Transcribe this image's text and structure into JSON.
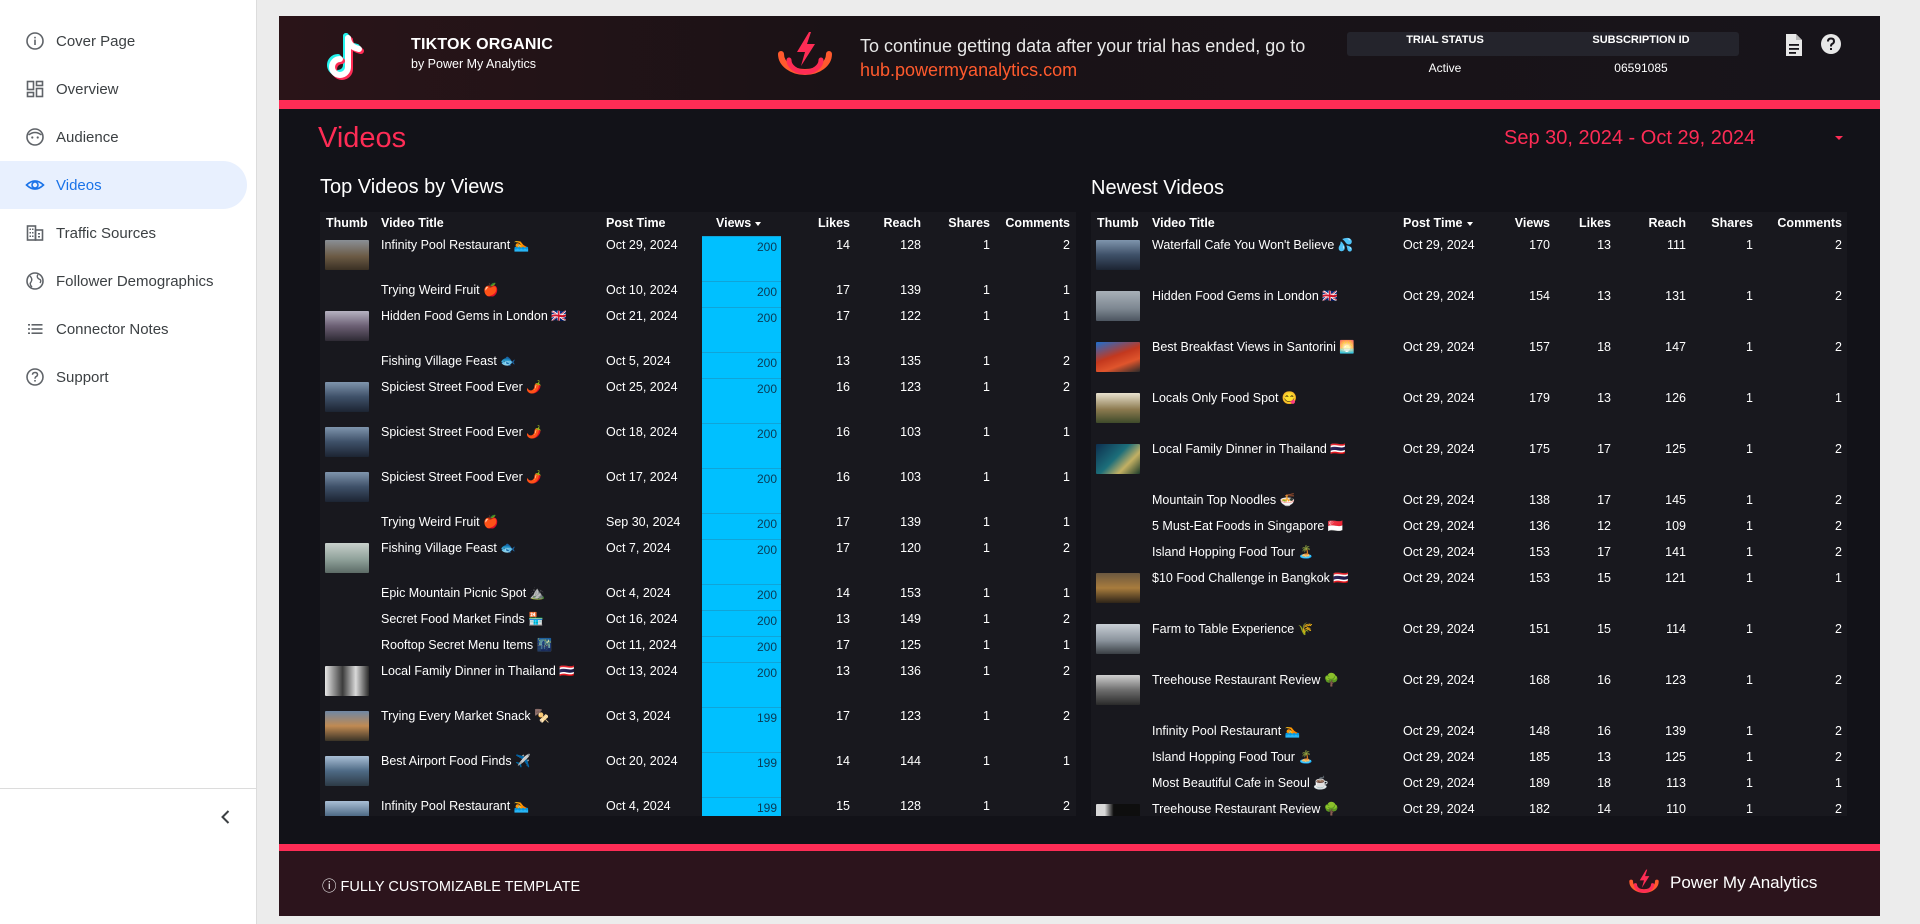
{
  "sidebar": {
    "items": [
      {
        "label": "Cover Page",
        "icon": "info-icon"
      },
      {
        "label": "Overview",
        "icon": "dashboard-icon"
      },
      {
        "label": "Audience",
        "icon": "face-icon"
      },
      {
        "label": "Videos",
        "icon": "eye-icon",
        "active": true
      },
      {
        "label": "Traffic Sources",
        "icon": "building-icon"
      },
      {
        "label": "Follower Demographics",
        "icon": "globe-icon"
      },
      {
        "label": "Connector Notes",
        "icon": "list-icon"
      },
      {
        "label": "Support",
        "icon": "help-circle-icon"
      }
    ]
  },
  "header": {
    "brand_title": "TIKTOK ORGANIC",
    "brand_sub": "by Power My Analytics",
    "trial_message": "To continue getting data after your trial has ended, go to",
    "trial_link": "hub.powermyanalytics.com",
    "trial_status_label": "TRIAL STATUS",
    "trial_status_value": "Active",
    "subscription_label": "SUBSCRIPTION ID",
    "subscription_value": "06591085"
  },
  "page": {
    "title": "Videos",
    "date_range": "Sep 30, 2024 - Oct 29, 2024"
  },
  "colors": {
    "accent": "#fe2c55",
    "views_fill": "#00c0ff",
    "link": "#ff5a2d"
  },
  "top_videos": {
    "title": "Top Videos by Views",
    "columns": [
      "Thumb",
      "Video Title",
      "Post Time",
      "Views",
      "Likes",
      "Reach",
      "Shares",
      "Comments"
    ],
    "rows": [
      {
        "thumb": "landscape",
        "title": "Infinity Pool Restaurant 🏊",
        "post_time": "Oct 29, 2024",
        "views": "200",
        "likes": "14",
        "reach": "128",
        "shares": "1",
        "comments": "2",
        "tall": true
      },
      {
        "thumb": "",
        "title": "Trying Weird Fruit 🍎",
        "post_time": "Oct 10, 2024",
        "views": "200",
        "likes": "17",
        "reach": "139",
        "shares": "1",
        "comments": "1",
        "tall": false
      },
      {
        "thumb": "forest",
        "title": "Hidden Food Gems in London 🇬🇧",
        "post_time": "Oct 21, 2024",
        "views": "200",
        "likes": "17",
        "reach": "122",
        "shares": "1",
        "comments": "1",
        "tall": true
      },
      {
        "thumb": "",
        "title": "Fishing Village Feast 🐟",
        "post_time": "Oct 5, 2024",
        "views": "200",
        "likes": "13",
        "reach": "135",
        "shares": "1",
        "comments": "2",
        "tall": false
      },
      {
        "thumb": "sky",
        "title": "Spiciest Street Food Ever 🌶️",
        "post_time": "Oct 25, 2024",
        "views": "200",
        "likes": "16",
        "reach": "123",
        "shares": "1",
        "comments": "2",
        "tall": true
      },
      {
        "thumb": "sky",
        "title": "Spiciest Street Food Ever 🌶️",
        "post_time": "Oct 18, 2024",
        "views": "200",
        "likes": "16",
        "reach": "103",
        "shares": "1",
        "comments": "1",
        "tall": true
      },
      {
        "thumb": "sky",
        "title": "Spiciest Street Food Ever 🌶️",
        "post_time": "Oct 17, 2024",
        "views": "200",
        "likes": "16",
        "reach": "103",
        "shares": "1",
        "comments": "1",
        "tall": true
      },
      {
        "thumb": "",
        "title": "Trying Weird Fruit 🍎",
        "post_time": "Sep 30, 2024",
        "views": "200",
        "likes": "17",
        "reach": "139",
        "shares": "1",
        "comments": "1",
        "tall": false
      },
      {
        "thumb": "mist",
        "title": "Fishing Village Feast 🐟",
        "post_time": "Oct 7, 2024",
        "views": "200",
        "likes": "17",
        "reach": "120",
        "shares": "1",
        "comments": "2",
        "tall": true
      },
      {
        "thumb": "",
        "title": "Epic Mountain Picnic Spot ⛰️",
        "post_time": "Oct 4, 2024",
        "views": "200",
        "likes": "14",
        "reach": "153",
        "shares": "1",
        "comments": "1",
        "tall": false
      },
      {
        "thumb": "",
        "title": "Secret Food Market Finds 🏪",
        "post_time": "Oct 16, 2024",
        "views": "200",
        "likes": "13",
        "reach": "149",
        "shares": "1",
        "comments": "2",
        "tall": false
      },
      {
        "thumb": "",
        "title": "Rooftop Secret Menu Items 🌃",
        "post_time": "Oct 11, 2024",
        "views": "200",
        "likes": "17",
        "reach": "125",
        "shares": "1",
        "comments": "1",
        "tall": false
      },
      {
        "thumb": "people",
        "title": "Local Family Dinner in Thailand 🇹🇭",
        "post_time": "Oct 13, 2024",
        "views": "200",
        "likes": "13",
        "reach": "136",
        "shares": "1",
        "comments": "2",
        "tall": true
      },
      {
        "thumb": "sunset",
        "title": "Trying Every Market Snack 🍢",
        "post_time": "Oct 3, 2024",
        "views": "199",
        "likes": "17",
        "reach": "123",
        "shares": "1",
        "comments": "2",
        "tall": true
      },
      {
        "thumb": "coast",
        "title": "Best Airport Food Finds ✈️",
        "post_time": "Oct 20, 2024",
        "views": "199",
        "likes": "14",
        "reach": "144",
        "shares": "1",
        "comments": "1",
        "tall": true
      },
      {
        "thumb": "coast",
        "title": "Infinity Pool Restaurant 🏊",
        "post_time": "Oct 4, 2024",
        "views": "199",
        "likes": "15",
        "reach": "128",
        "shares": "1",
        "comments": "2",
        "tall": true
      }
    ]
  },
  "newest_videos": {
    "title": "Newest Videos",
    "columns": [
      "Thumb",
      "Video Title",
      "Post Time",
      "Views",
      "Likes",
      "Reach",
      "Shares",
      "Comments"
    ],
    "rows": [
      {
        "thumb": "sky",
        "title": "Waterfall Cafe You Won't Believe 💦",
        "post_time": "Oct 29, 2024",
        "views": "170",
        "likes": "13",
        "reach": "111",
        "shares": "1",
        "comments": "2",
        "tall": true
      },
      {
        "thumb": "birds",
        "title": "Hidden Food Gems in London 🇬🇧",
        "post_time": "Oct 29, 2024",
        "views": "154",
        "likes": "13",
        "reach": "131",
        "shares": "1",
        "comments": "2",
        "tall": true
      },
      {
        "thumb": "red",
        "title": "Best Breakfast Views in Santorini 🌅",
        "post_time": "Oct 29, 2024",
        "views": "157",
        "likes": "18",
        "reach": "147",
        "shares": "1",
        "comments": "2",
        "tall": true
      },
      {
        "thumb": "temple",
        "title": "Locals Only Food Spot 😋",
        "post_time": "Oct 29, 2024",
        "views": "179",
        "likes": "13",
        "reach": "126",
        "shares": "1",
        "comments": "1",
        "tall": true
      },
      {
        "thumb": "aerial",
        "title": "Local Family Dinner in Thailand 🇹🇭",
        "post_time": "Oct 29, 2024",
        "views": "175",
        "likes": "17",
        "reach": "125",
        "shares": "1",
        "comments": "2",
        "tall": true
      },
      {
        "thumb": "",
        "title": "Mountain Top Noodles 🍜",
        "post_time": "Oct 29, 2024",
        "views": "138",
        "likes": "17",
        "reach": "145",
        "shares": "1",
        "comments": "2",
        "tall": false
      },
      {
        "thumb": "",
        "title": "5 Must-Eat Foods in Singapore 🇸🇬",
        "post_time": "Oct 29, 2024",
        "views": "136",
        "likes": "12",
        "reach": "109",
        "shares": "1",
        "comments": "2",
        "tall": false
      },
      {
        "thumb": "",
        "title": "Island Hopping Food Tour 🏝️",
        "post_time": "Oct 29, 2024",
        "views": "153",
        "likes": "17",
        "reach": "141",
        "shares": "1",
        "comments": "2",
        "tall": false
      },
      {
        "thumb": "street",
        "title": "$10 Food Challenge in Bangkok 🇹🇭",
        "post_time": "Oct 29, 2024",
        "views": "153",
        "likes": "15",
        "reach": "121",
        "shares": "1",
        "comments": "1",
        "tall": true
      },
      {
        "thumb": "road",
        "title": "Farm to Table Experience 🌾",
        "post_time": "Oct 29, 2024",
        "views": "151",
        "likes": "15",
        "reach": "114",
        "shares": "1",
        "comments": "2",
        "tall": true
      },
      {
        "thumb": "hall",
        "title": "Treehouse Restaurant Review 🌳",
        "post_time": "Oct 29, 2024",
        "views": "168",
        "likes": "16",
        "reach": "123",
        "shares": "1",
        "comments": "2",
        "tall": true
      },
      {
        "thumb": "",
        "title": "Infinity Pool Restaurant 🏊",
        "post_time": "Oct 29, 2024",
        "views": "148",
        "likes": "16",
        "reach": "139",
        "shares": "1",
        "comments": "2",
        "tall": false
      },
      {
        "thumb": "",
        "title": "Island Hopping Food Tour 🏝️",
        "post_time": "Oct 29, 2024",
        "views": "185",
        "likes": "13",
        "reach": "125",
        "shares": "1",
        "comments": "2",
        "tall": false
      },
      {
        "thumb": "",
        "title": "Most Beautiful Cafe in Seoul ☕",
        "post_time": "Oct 29, 2024",
        "views": "189",
        "likes": "18",
        "reach": "113",
        "shares": "1",
        "comments": "1",
        "tall": false
      },
      {
        "thumb": "dark",
        "title": "Treehouse Restaurant Review 🌳",
        "post_time": "Oct 29, 2024",
        "views": "182",
        "likes": "14",
        "reach": "110",
        "shares": "1",
        "comments": "2",
        "tall": true
      }
    ]
  },
  "footer": {
    "note": "ⓘ FULLY CUSTOMIZABLE TEMPLATE",
    "brand": "Power My Analytics"
  }
}
